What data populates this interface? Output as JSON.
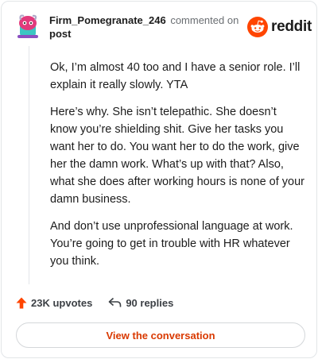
{
  "comment": {
    "author": "Firm_Pomegranate_246",
    "action_text": "commented on",
    "target": "post",
    "paragraphs": [
      "Ok, I’m almost 40 too and I have a senior role. I’ll explain it really slowly. YTA",
      "Here’s why. She isn’t telepathic. She doesn’t know you’re shielding shit. Give her tasks you want her to do. You want her to do the work, give her the damn work. What’s up with that? Also, what she does after working hours is none of your damn business.",
      "And don’t use unprofessional language at work. You’re going to get in trouble with HR whatever you think."
    ]
  },
  "brand": {
    "wordmark": "reddit",
    "accent": "#ff4500"
  },
  "stats": {
    "upvotes": "23K upvotes",
    "replies": "90 replies"
  },
  "cta": {
    "label": "View the conversation"
  },
  "colors": {
    "cta_text": "#d93900",
    "upvote_icon": "#ff4500"
  },
  "icons": {
    "upvote": "upvote-arrow-icon",
    "reply": "reply-arrow-icon",
    "logo": "reddit-snoo-icon",
    "avatar": "user-avatar"
  }
}
